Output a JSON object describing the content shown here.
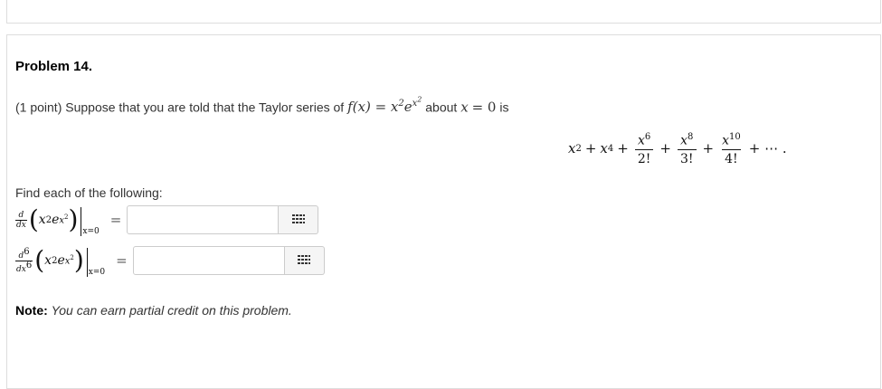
{
  "problem": {
    "title": "Problem 14.",
    "intro_prefix": "(1 point) Suppose that you are told that the Taylor series of",
    "intro_about": "about",
    "intro_x": "x",
    "intro_eq0": "= 0",
    "intro_is": "is",
    "find_text": "Find each of the following:",
    "note_label": "Note:",
    "note_text": "You can earn partial credit on this problem."
  },
  "series": {
    "trailing": "+ ⋯ .",
    "denominators": [
      "2!",
      "3!",
      "4!"
    ]
  },
  "answers": [
    {
      "order_label": "d",
      "value": "",
      "sub": "x=0"
    },
    {
      "order_label": "d6",
      "value": "",
      "sub": "x=0"
    }
  ],
  "icons": {
    "palette": "grid-icon"
  }
}
